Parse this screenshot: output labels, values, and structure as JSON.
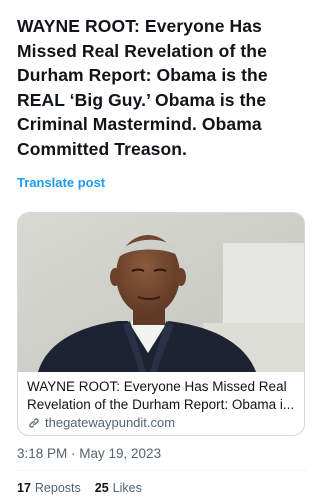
{
  "post": {
    "text": "WAYNE ROOT: Everyone Has Missed Real Revelation of the Durham Report: Obama is the REAL ‘Big Guy.’ Obama is the Criminal Mastermind. Obama Committed Treason.",
    "translate_label": "Translate post",
    "timestamp": "3:18 PM · May 19, 2023"
  },
  "card": {
    "title": "WAYNE ROOT: Everyone Has Missed Real Revelation of the Durham Report: Obama i...",
    "domain": "thegatewaypundit.com",
    "domain_icon": "link-icon"
  },
  "stats": {
    "reposts_count": "17",
    "reposts_label": "Reposts",
    "likes_count": "25",
    "likes_label": "Likes"
  },
  "colors": {
    "accent": "#1d9bf0",
    "text": "#0f1419",
    "muted": "#536471",
    "border": "#cfd9de"
  }
}
